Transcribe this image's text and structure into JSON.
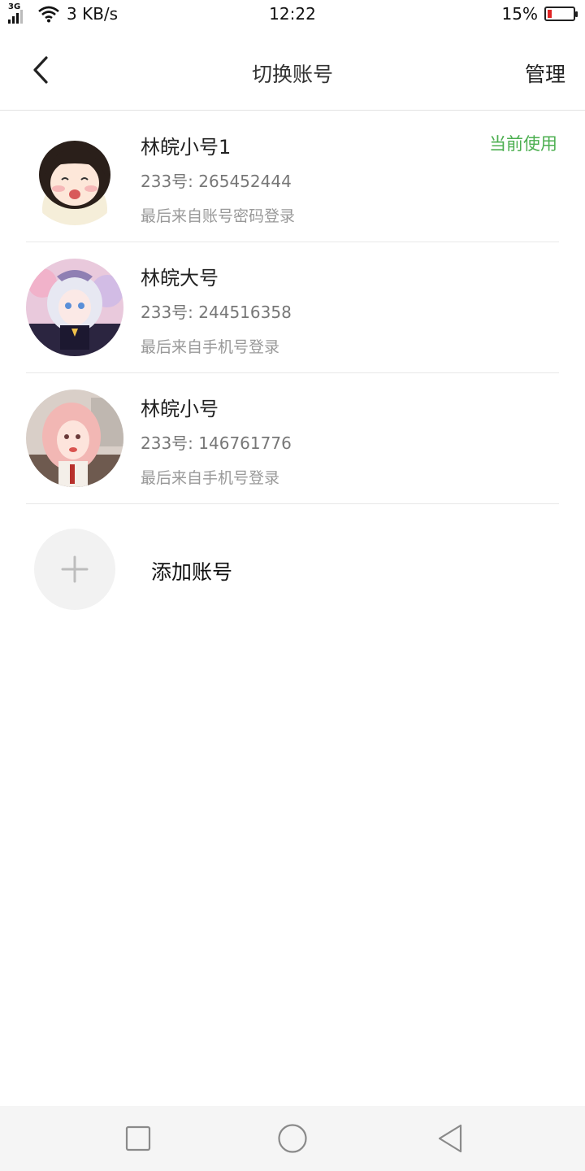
{
  "status_bar": {
    "network_type": "3G",
    "net_speed": "3 KB/s",
    "time": "12:22",
    "battery_text": "15%",
    "battery_level": 0.15
  },
  "nav": {
    "title": "切换账号",
    "manage_label": "管理",
    "back_icon": "chevron-left-icon"
  },
  "accounts": [
    {
      "name": "林皖小号1",
      "id_text": "233号: 265452444",
      "login_text": "最后来自账号密码登录",
      "badge": "当前使用"
    },
    {
      "name": "林皖大号",
      "id_text": "233号: 244516358",
      "login_text": "最后来自手机号登录"
    },
    {
      "name": "林皖小号",
      "id_text": "233号: 146761776",
      "login_text": "最后来自手机号登录"
    }
  ],
  "add_account": {
    "label": "添加账号",
    "icon": "plus-icon"
  },
  "system_nav": {
    "recents_icon": "square-icon",
    "home_icon": "circle-icon",
    "back_icon": "triangle-back-icon"
  },
  "colors": {
    "accent_green": "#4caf50",
    "battery_red": "#e02424",
    "divider": "#e8e8e8"
  }
}
